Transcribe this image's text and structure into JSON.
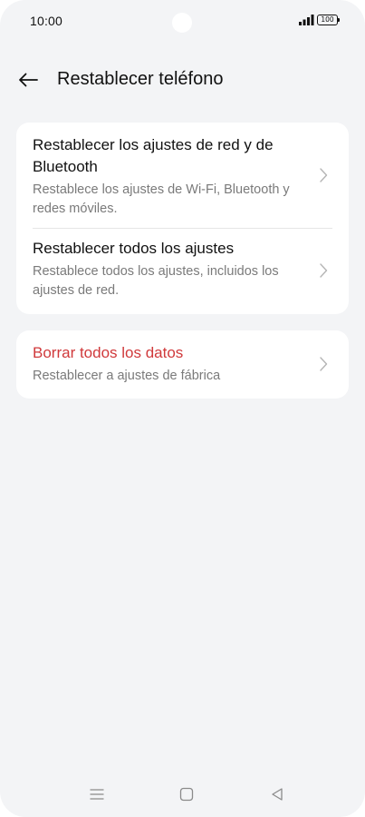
{
  "status_bar": {
    "time": "10:00",
    "battery_level": "100",
    "icons": [
      "signal-icon",
      "battery-icon"
    ]
  },
  "header": {
    "back_icon": "arrow-left-icon",
    "title": "Restablecer teléfono"
  },
  "sections": [
    {
      "items": [
        {
          "title": "Restablecer los ajustes de red y de Bluetooth",
          "subtitle": "Restablece los ajustes de Wi-Fi, Bluetooth y redes móviles.",
          "icon": "chevron-right-icon"
        },
        {
          "title": "Restablecer todos los ajustes",
          "subtitle": "Restablece todos los ajustes, incluidos los ajustes de red.",
          "icon": "chevron-right-icon"
        }
      ]
    },
    {
      "items": [
        {
          "title": "Borrar todos los datos",
          "subtitle": "Restablecer a ajustes de fábrica",
          "icon": "chevron-right-icon",
          "title_color": "#d0393b"
        }
      ]
    }
  ],
  "nav_bar": {
    "icons": [
      "menu-icon",
      "home-icon",
      "back-triangle-icon"
    ]
  },
  "colors": {
    "background": "#f3f4f6",
    "card": "#ffffff",
    "danger": "#d0393b",
    "secondary_text": "#7a7a7a"
  }
}
